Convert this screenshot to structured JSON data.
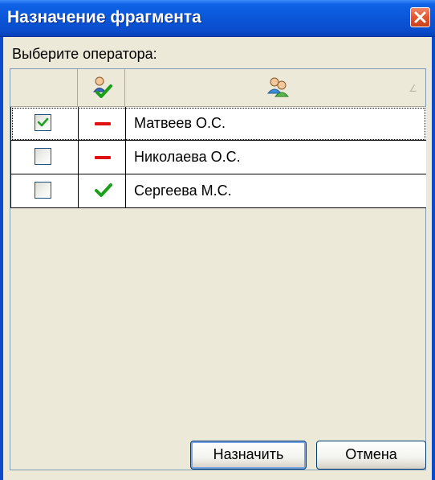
{
  "window": {
    "title": "Назначение фрагмента",
    "close_icon": "close-icon"
  },
  "prompt": "Выберите оператора:",
  "columns": {
    "check": {
      "icon": ""
    },
    "status": {
      "icon": "user-check-icon"
    },
    "name": {
      "icon": "users-icon",
      "sort_indicator": "sort-indicator-icon"
    }
  },
  "operators": [
    {
      "checked": true,
      "status": "inactive",
      "status_icon": "minus-icon",
      "name": "Матвеев О.С."
    },
    {
      "checked": false,
      "status": "inactive",
      "status_icon": "minus-icon",
      "name": "Николаева О.С."
    },
    {
      "checked": false,
      "status": "active",
      "status_icon": "check-icon",
      "name": "Сергеева М.С."
    }
  ],
  "buttons": {
    "assign_label": "Назначить",
    "cancel_label": "Отмена"
  },
  "colors": {
    "titlebar": "#0a55d6",
    "inactive_status": "#e01010",
    "active_status": "#1aa11a",
    "checkmark": "#21a121"
  }
}
